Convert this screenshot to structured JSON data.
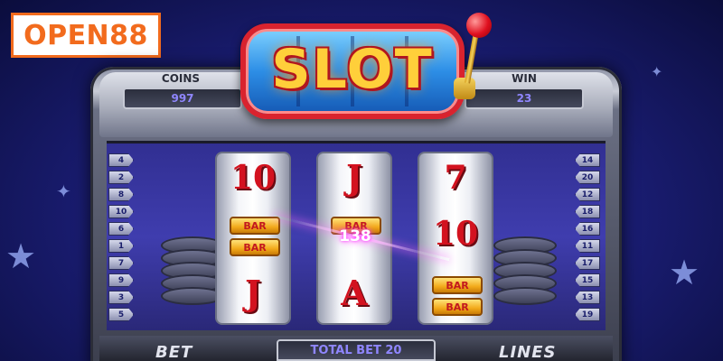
{
  "brand": {
    "logo_text": "OPEN88",
    "color": "#f26b1d"
  },
  "sign": {
    "text": "SLOT"
  },
  "counters": {
    "coins_label": "COINS",
    "coins_value": "997",
    "win_label": "WIN",
    "win_value": "23"
  },
  "paylines": {
    "left": [
      "4",
      "2",
      "8",
      "10",
      "6",
      "1",
      "7",
      "9",
      "3",
      "5"
    ],
    "right": [
      "14",
      "20",
      "12",
      "18",
      "16",
      "11",
      "17",
      "15",
      "13",
      "19"
    ]
  },
  "reels": [
    {
      "top": "10",
      "middle": [
        "BAR",
        "BAR"
      ],
      "bottom": "J"
    },
    {
      "top": "J",
      "middle": [
        "BAR"
      ],
      "bottom": "A"
    },
    {
      "top": "7",
      "middle": [
        "10"
      ],
      "bottom": [
        "BAR",
        "BAR"
      ]
    }
  ],
  "win_popup": "138",
  "controls": {
    "bet_label": "BET",
    "total_bet": "TOTAL BET 20",
    "lines_label": "LINES"
  },
  "colors": {
    "reel_symbol": "#d3121f",
    "counter_text": "#8f86ff",
    "sign_frame": "#d9232e"
  }
}
